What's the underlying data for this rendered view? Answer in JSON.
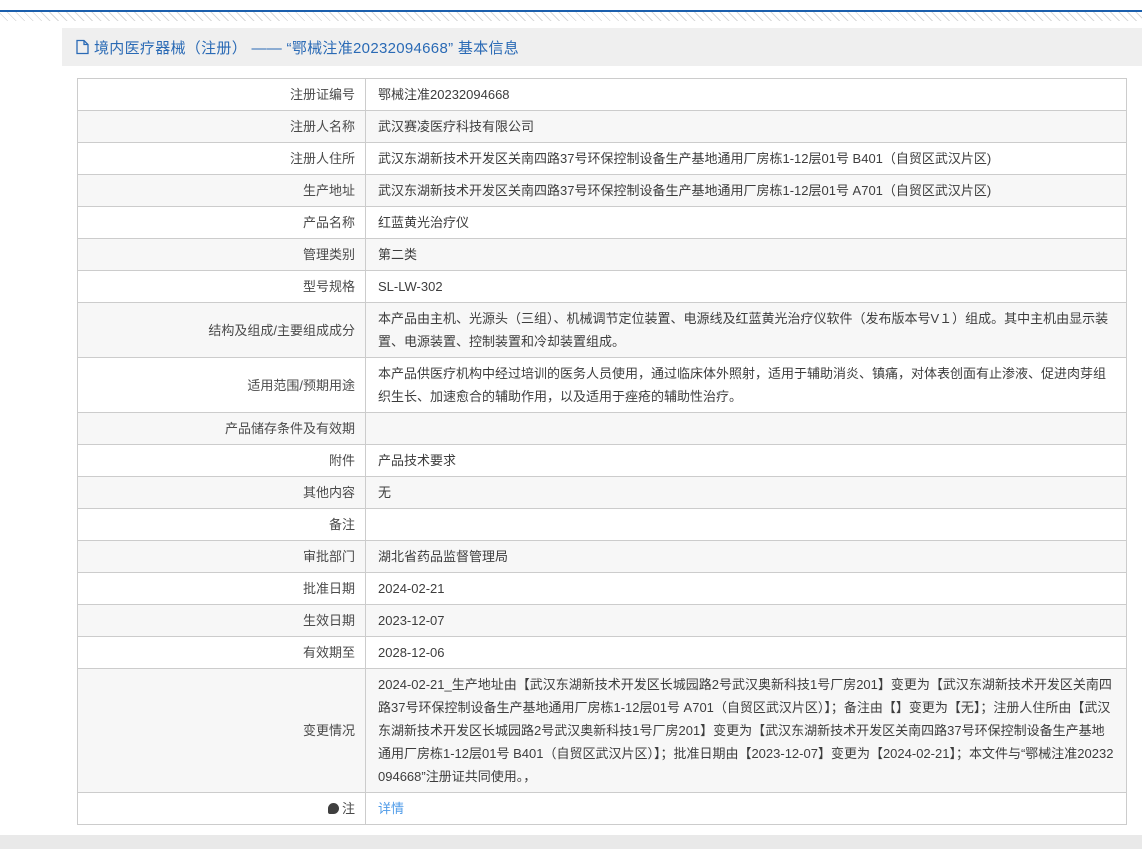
{
  "colors": {
    "accent_blue": "#2a6ab5",
    "link_blue": "#4f9be8",
    "top_line_blue": "#1b5fad",
    "header_band_gray": "#efefef",
    "zebra_gray": "#f7f7f7",
    "border_gray": "#cccccc"
  },
  "header": {
    "title": "境内医疗器械（注册） —— “鄂械注准20232094668” 基本信息"
  },
  "table": {
    "rows": [
      {
        "label": "注册证编号",
        "value": "鄂械注准20232094668",
        "type": "text"
      },
      {
        "label": "注册人名称",
        "value": "武汉赛凌医疗科技有限公司",
        "type": "text"
      },
      {
        "label": "注册人住所",
        "value": "武汉东湖新技术开发区关南四路37号环保控制设备生产基地通用厂房栋1-12层01号 B401（自贸区武汉片区)",
        "type": "text"
      },
      {
        "label": "生产地址",
        "value": "武汉东湖新技术开发区关南四路37号环保控制设备生产基地通用厂房栋1-12层01号 A701（自贸区武汉片区)",
        "type": "text"
      },
      {
        "label": "产品名称",
        "value": "红蓝黄光治疗仪",
        "type": "text"
      },
      {
        "label": "管理类别",
        "value": "第二类",
        "type": "text"
      },
      {
        "label": "型号规格",
        "value": "SL-LW-302",
        "type": "text"
      },
      {
        "label": "结构及组成/主要组成成分",
        "value": "本产品由主机、光源头（三组）、机械调节定位装置、电源线及红蓝黄光治疗仪软件（发布版本号V１）组成。其中主机由显示装置、电源装置、控制装置和冷却装置组成。",
        "type": "text"
      },
      {
        "label": "适用范围/预期用途",
        "value": "本产品供医疗机构中经过培训的医务人员使用，通过临床体外照射，适用于辅助消炎、镇痛，对体表创面有止渗液、促进肉芽组织生长、加速愈合的辅助作用，以及适用于痤疮的辅助性治疗。",
        "type": "text"
      },
      {
        "label": "产品储存条件及有效期",
        "value": "",
        "type": "text"
      },
      {
        "label": "附件",
        "value": "产品技术要求",
        "type": "text"
      },
      {
        "label": "其他内容",
        "value": "无",
        "type": "text"
      },
      {
        "label": "备注",
        "value": "",
        "type": "text"
      },
      {
        "label": "审批部门",
        "value": "湖北省药品监督管理局",
        "type": "text"
      },
      {
        "label": "批准日期",
        "value": "2024-02-21",
        "type": "text"
      },
      {
        "label": "生效日期",
        "value": "2023-12-07",
        "type": "text"
      },
      {
        "label": "有效期至",
        "value": "2028-12-06",
        "type": "text"
      },
      {
        "label": "变更情况",
        "value": "2024-02-21_生产地址由【武汉东湖新技术开发区长城园路2号武汉奥新科技1号厂房201】变更为【武汉东湖新技术开发区关南四路37号环保控制设备生产基地通用厂房栋1-12层01号 A701（自贸区武汉片区）】；备注由【】变更为【无】；注册人住所由【武汉东湖新技术开发区长城园路2号武汉奥新科技1号厂房201】变更为【武汉东湖新技术开发区关南四路37号环保控制设备生产基地通用厂房栋1-12层01号 B401（自贸区武汉片区）】；批准日期由【2023-12-07】变更为【2024-02-21】；本文件与“鄂械注准20232094668”注册证共同使用。，",
        "type": "text"
      },
      {
        "label": "注",
        "label_icon": "note-balloon-icon",
        "value": "详情",
        "type": "link"
      }
    ]
  }
}
